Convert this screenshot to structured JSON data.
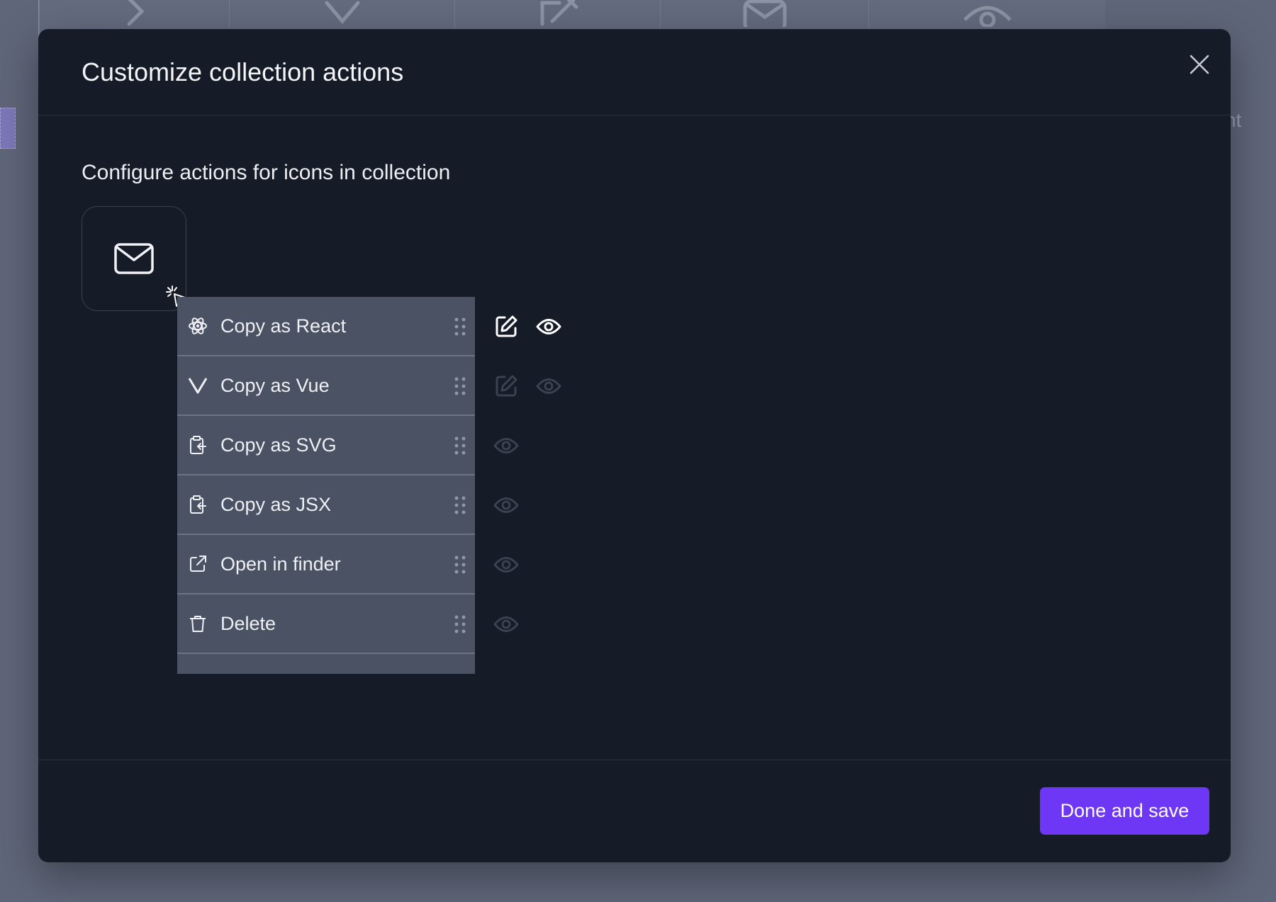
{
  "background": {
    "toolbar_icons": [
      "chevron-right-icon",
      "x-icon",
      "edit-icon",
      "mail-icon",
      "eye-icon"
    ],
    "partial_text": "ht"
  },
  "modal": {
    "title": "Customize collection actions",
    "close_icon": "close-icon",
    "section_label": "Configure actions for icons in collection",
    "preview_icon": "mail-icon",
    "actions": [
      {
        "label": "Copy as React",
        "icon": "react-icon",
        "editable": true,
        "visible": true,
        "active": true
      },
      {
        "label": "Copy as Vue",
        "icon": "vue-icon",
        "editable": true,
        "visible": false,
        "active": false
      },
      {
        "label": "Copy as SVG",
        "icon": "clipboard-copy-icon",
        "editable": false,
        "visible": false,
        "active": false
      },
      {
        "label": "Copy as JSX",
        "icon": "clipboard-copy-icon",
        "editable": false,
        "visible": false,
        "active": false
      },
      {
        "label": "Open in finder",
        "icon": "external-link-icon",
        "editable": false,
        "visible": false,
        "active": false
      },
      {
        "label": "Delete",
        "icon": "trash-icon",
        "editable": false,
        "visible": false,
        "active": false
      }
    ],
    "footer": {
      "done_label": "Done and save"
    }
  },
  "colors": {
    "accent": "#6e36f5",
    "modal_bg": "#161c27",
    "menu_bg": "#4a5263",
    "backdrop": "#5f6679"
  }
}
